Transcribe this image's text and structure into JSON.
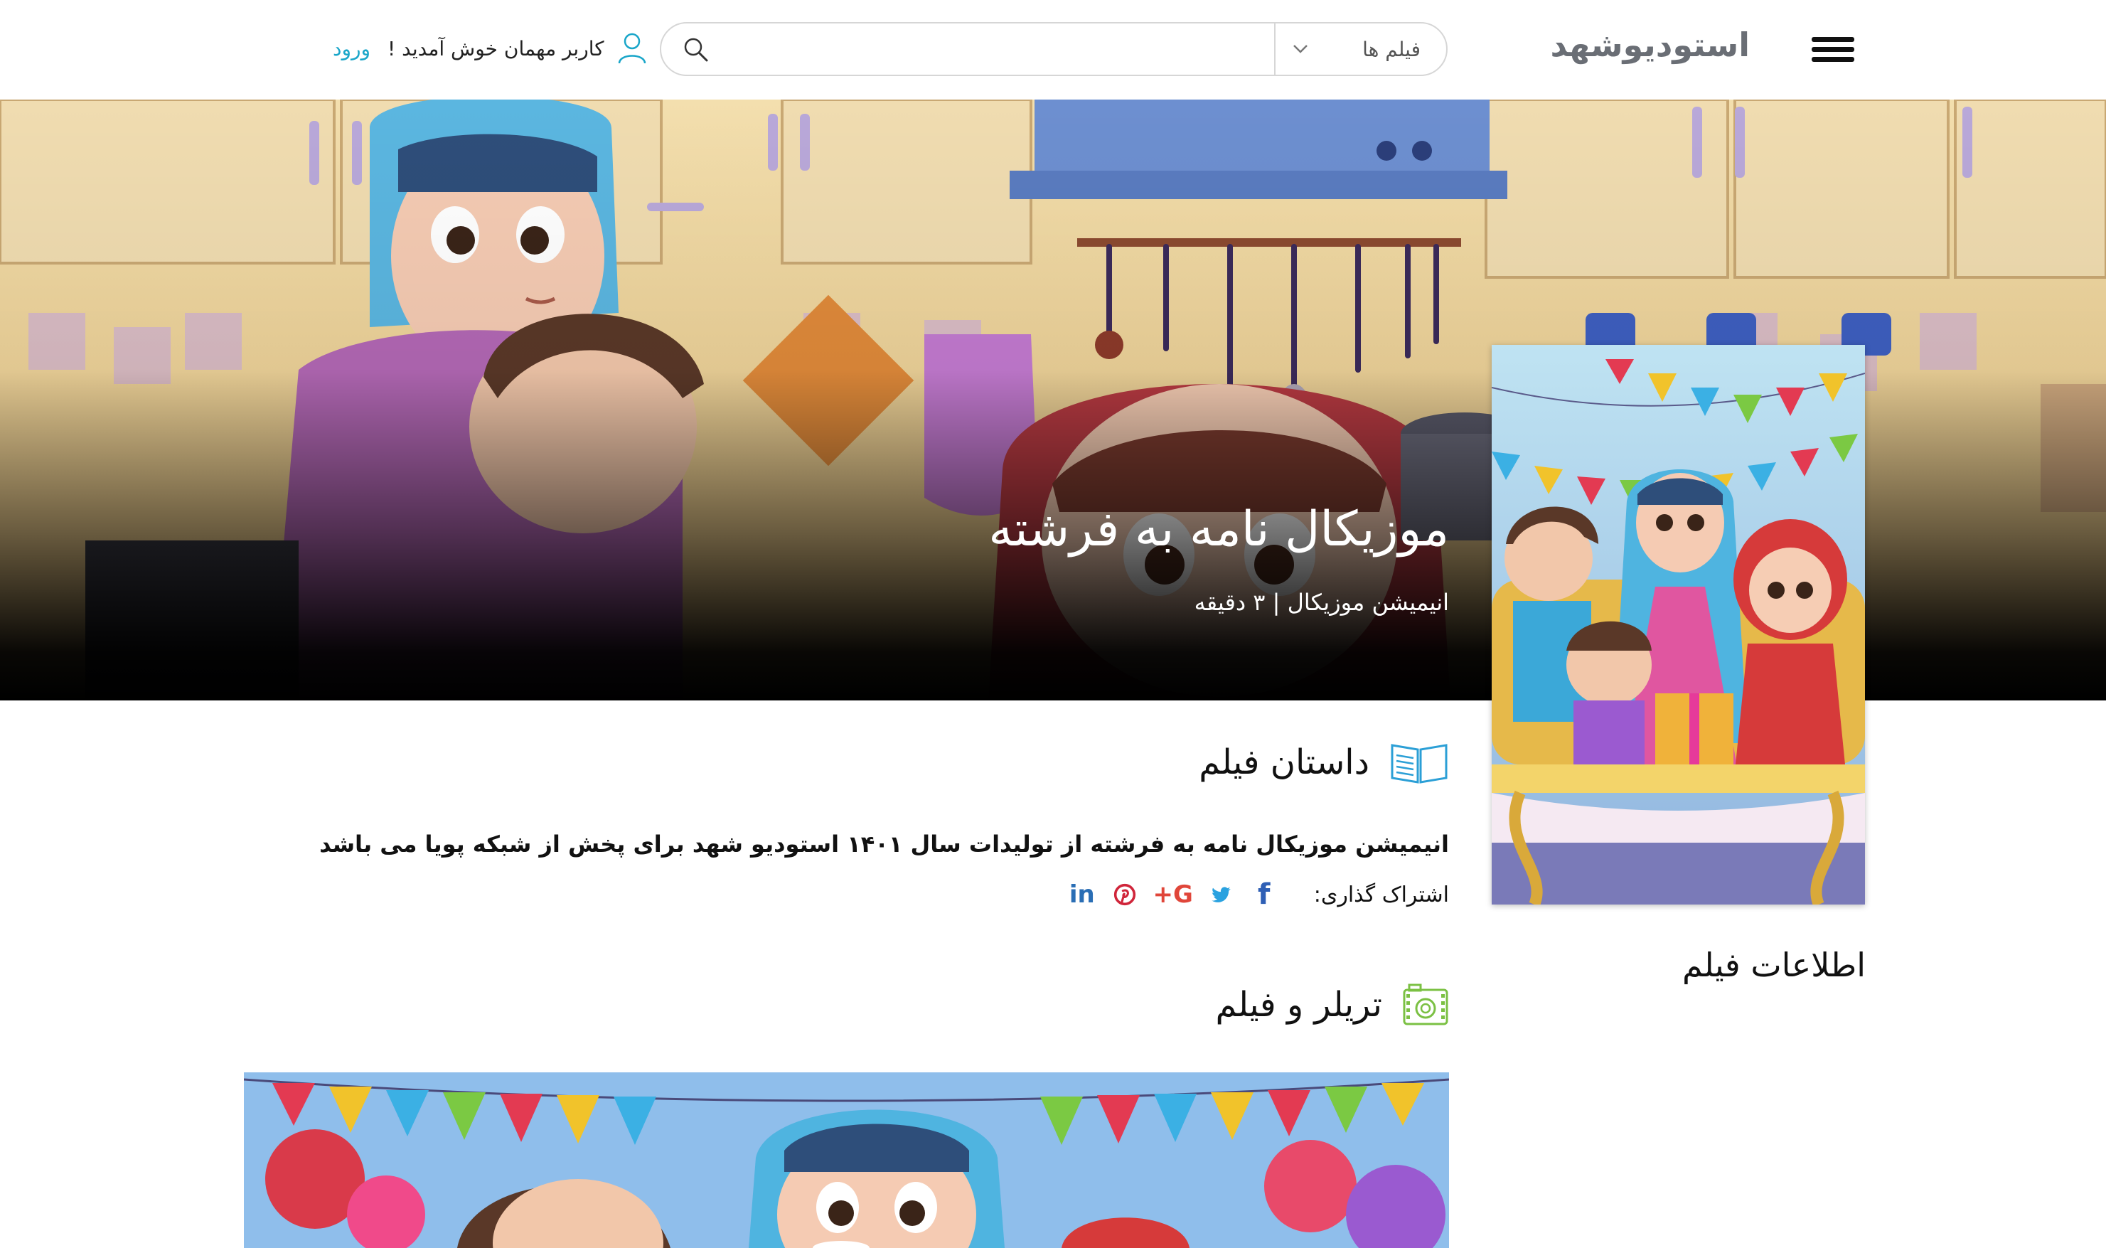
{
  "header": {
    "logo_text": "استودیوشهد",
    "search": {
      "category_selected": "فیلم ها",
      "placeholder": ""
    },
    "user": {
      "welcome_text": "کاربر مهمان خوش آمدید !",
      "login_label": "ورود"
    }
  },
  "hero": {
    "title": "موزیکال نامه به فرشته",
    "subtitle": "انیمیشن موزیکال | ۳ دقیقه"
  },
  "sidebar": {
    "heading": "اطلاعات فیلم"
  },
  "story": {
    "heading": "داستان فیلم",
    "text": "انیمیشن موزیکال نامه به فرشته از تولیدات سال ۱۴۰۱ استودیو شهد برای پخش از شبکه پویا می باشد"
  },
  "share": {
    "label": "اشتراک گذاری:",
    "networks": [
      "facebook-icon",
      "twitter-icon",
      "google-plus-icon",
      "pinterest-icon",
      "linkedin-icon"
    ]
  },
  "trailer": {
    "heading": "تریلر و فیلم"
  },
  "colors": {
    "accent": "#1aa6c9",
    "logo_gray": "#6a6e75",
    "facebook": "#2f5fb5",
    "twitter": "#2aa2e0",
    "google_plus": "#e0463a",
    "pinterest": "#d0253a",
    "linkedin": "#2a6eb5"
  }
}
